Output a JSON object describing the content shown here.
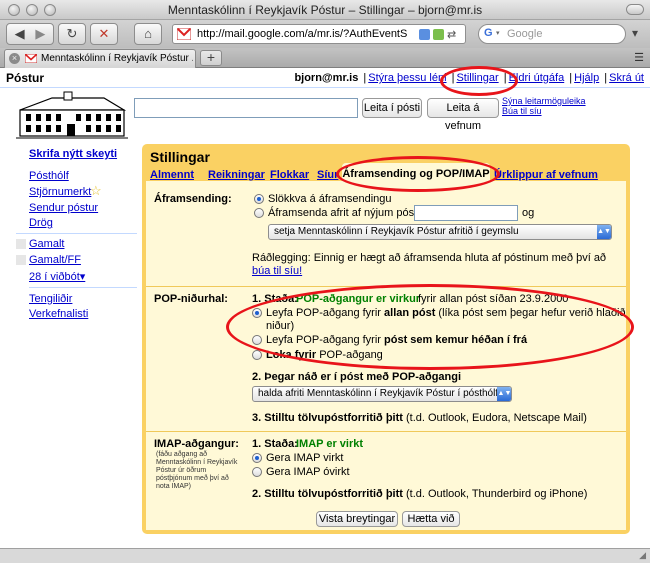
{
  "window": {
    "title": "Menntaskólinn í Reykjavík Póstur – Stillingar – bjorn@mr.is",
    "url": "http://mail.google.com/a/mr.is/?AuthEventS",
    "search_placeholder": "Google",
    "tab_label": "Menntaskólinn í Reykjavík Póstur ..."
  },
  "header": {
    "brand": "Póstur",
    "user": "bjorn@mr.is",
    "links": [
      "Stýra þessu léni",
      "Stillingar",
      "Eldri útgáfa",
      "Hjálp",
      "Skrá út"
    ]
  },
  "search": {
    "search_mail_button": "Leita í pósti",
    "search_web_button": "Leita á vefnum",
    "show_options": "Sýna leitarmöguleika",
    "create_filter": "Búa til síu"
  },
  "sidebar": {
    "compose": "Skrifa nýtt skeyti",
    "items": [
      "Pósthólf",
      "Stjörnumerkt",
      "Sendur póstur",
      "Drög"
    ],
    "labels": [
      "Gamalt",
      "Gamalt/FF",
      "28 í viðbót▾"
    ],
    "bottom": [
      "Tengiliðir",
      "Verkefnalisti"
    ]
  },
  "settings": {
    "title": "Stillingar",
    "tabs": [
      "Almennt",
      "Reikningar",
      "Flokkar",
      "Síur",
      "Áframsending og POP/IMAP",
      "Úrklippur af vefnum"
    ],
    "forwarding": {
      "label": "Áframsending:",
      "opt_off": "Slökkva á áframsendingu",
      "opt_on": "Áframsenda afrit af nýjum pósti á",
      "and": "og",
      "select": "setja Menntaskólinn í Reykjavík Póstur afritið í geymslu",
      "tip": "Ráðlegging: Einnig er hægt að áframsenda hluta af póstinum með því að",
      "tip_link": "búa til síu!"
    },
    "pop": {
      "label": "POP-niðurhal:",
      "step1_prefix": "1. Staða:",
      "step1_status": "POP-aðgangur er virkur",
      "step1_suffix": "fyrir allan póst síðan 23.9.2000",
      "opt_all_a": "Leyfa POP-aðgang fyrir",
      "opt_all_b": "allan póst",
      "opt_all_c": "(líka póst sem þegar hefur verið hlaðið",
      "opt_all_d": "niður)",
      "opt_new_a": "Leyfa POP-aðgang fyrir",
      "opt_new_b": "póst sem kemur héðan í frá",
      "opt_off_a": "Loka fyrir",
      "opt_off_b": "POP-aðgang",
      "step2": "2. Þegar náð er í póst með POP-aðgangi",
      "select": "halda afriti Menntaskólinn í Reykjavík Póstur í pósthólfinu",
      "step3_a": "3. Stilltu tölvupóstforritið þitt",
      "step3_b": "(t.d. Outlook, Eudora, Netscape Mail)"
    },
    "imap": {
      "label": "IMAP-aðgangur:",
      "note": [
        "(fáðu aðgang að",
        "Menntaskólinn í Reykjavík",
        "Póstur úr öðrum",
        "póstþjónum með því að",
        "nota IMAP)"
      ],
      "step1_prefix": "1. Staða:",
      "step1_status": "IMAP er virkt",
      "opt_on": "Gera IMAP virkt",
      "opt_off": "Gera IMAP óvirkt",
      "step2_a": "2. Stilltu tölvupóstforritið þitt",
      "step2_b": "(t.d. Outlook, Thunderbird og iPhone)"
    },
    "save": "Vista breytingar",
    "cancel": "Hætta við"
  }
}
